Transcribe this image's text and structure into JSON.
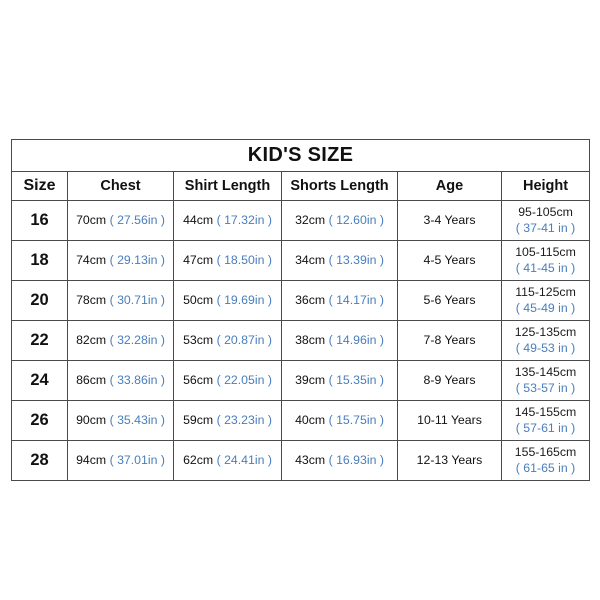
{
  "table": {
    "title": "KID'S SIZE",
    "columns": [
      {
        "key": "size",
        "label": "Size"
      },
      {
        "key": "chest",
        "label": "Chest"
      },
      {
        "key": "shirt",
        "label": "Shirt Length"
      },
      {
        "key": "shorts",
        "label": "Shorts Length"
      },
      {
        "key": "age",
        "label": "Age"
      },
      {
        "key": "height",
        "label": "Height"
      }
    ],
    "accent_inch_color": "#4a7ebb",
    "text_color": "#111111",
    "border_color": "#4a4a4a",
    "rows": [
      {
        "size": "16",
        "chest_cm": "70cm",
        "chest_in": "( 27.56in )",
        "shirt_cm": "44cm",
        "shirt_in": "( 17.32in )",
        "shorts_cm": "32cm",
        "shorts_in": "( 12.60in )",
        "age": "3-4 Years",
        "height_cm": "95-105cm",
        "height_in": "( 37-41 in )"
      },
      {
        "size": "18",
        "chest_cm": "74cm",
        "chest_in": "( 29.13in )",
        "shirt_cm": "47cm",
        "shirt_in": "( 18.50in )",
        "shorts_cm": "34cm",
        "shorts_in": "( 13.39in )",
        "age": "4-5 Years",
        "height_cm": "105-115cm",
        "height_in": "( 41-45 in )"
      },
      {
        "size": "20",
        "chest_cm": "78cm",
        "chest_in": "( 30.71in )",
        "shirt_cm": "50cm",
        "shirt_in": "( 19.69in )",
        "shorts_cm": "36cm",
        "shorts_in": "( 14.17in )",
        "age": "5-6 Years",
        "height_cm": "115-125cm",
        "height_in": "( 45-49 in )"
      },
      {
        "size": "22",
        "chest_cm": "82cm",
        "chest_in": "( 32.28in )",
        "shirt_cm": "53cm",
        "shirt_in": "( 20.87in )",
        "shorts_cm": "38cm",
        "shorts_in": "( 14.96in )",
        "age": "7-8 Years",
        "height_cm": "125-135cm",
        "height_in": "( 49-53 in )"
      },
      {
        "size": "24",
        "chest_cm": "86cm",
        "chest_in": "( 33.86in )",
        "shirt_cm": "56cm",
        "shirt_in": "( 22.05in )",
        "shorts_cm": "39cm",
        "shorts_in": "( 15.35in )",
        "age": "8-9 Years",
        "height_cm": "135-145cm",
        "height_in": "( 53-57 in )"
      },
      {
        "size": "26",
        "chest_cm": "90cm",
        "chest_in": "( 35.43in )",
        "shirt_cm": "59cm",
        "shirt_in": "( 23.23in )",
        "shorts_cm": "40cm",
        "shorts_in": "( 15.75in )",
        "age": "10-11 Years",
        "height_cm": "145-155cm",
        "height_in": "( 57-61 in )"
      },
      {
        "size": "28",
        "chest_cm": "94cm",
        "chest_in": "( 37.01in )",
        "shirt_cm": "62cm",
        "shirt_in": "( 24.41in )",
        "shorts_cm": "43cm",
        "shorts_in": "( 16.93in )",
        "age": "12-13 Years",
        "height_cm": "155-165cm",
        "height_in": "( 61-65 in )"
      }
    ]
  }
}
